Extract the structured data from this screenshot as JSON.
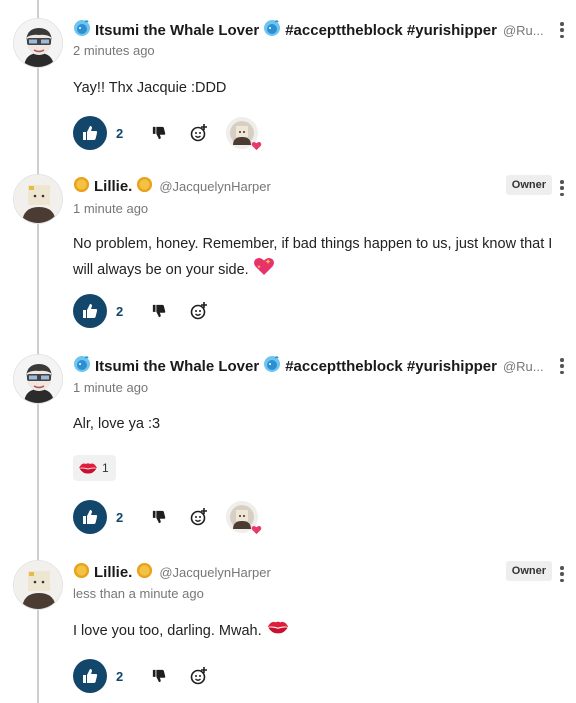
{
  "comments": [
    {
      "author": "Itsumi the Whale Lover",
      "hashtags": "#accepttheblock #yurishipper",
      "handle": "@Ru...",
      "time": "2 minutes ago",
      "text": "Yay!! Thx Jacquie :DDD",
      "likes": "2",
      "owner": ""
    },
    {
      "author": "Lillie.",
      "hashtags": "",
      "handle": "@JacquelynHarper",
      "time": "1 minute ago",
      "text": "No problem, honey. Remember, if bad things happen to us, just know that I will always be on your side.",
      "likes": "2",
      "owner": "Owner"
    },
    {
      "author": "Itsumi the Whale Lover",
      "hashtags": "#accepttheblock #yurishipper",
      "handle": "@Ru...",
      "time": "1 minute ago",
      "text": "Alr, love ya :3",
      "likes": "2",
      "owner": "",
      "reaction_count": "1"
    },
    {
      "author": "Lillie.",
      "hashtags": "",
      "handle": "@JacquelynHarper",
      "time": "less than a minute ago",
      "text": "I love you too, darling. Mwah.",
      "likes": "2",
      "owner": "Owner"
    }
  ],
  "colors": {
    "like_button": "#13466b",
    "owner_badge_bg": "#eeeeee",
    "thread_line": "#cfcfcf"
  },
  "icons": [
    "whale-emoji",
    "sun-emoji",
    "thumbs-up-icon",
    "thumbs-down-icon",
    "add-reaction-icon",
    "sparkling-heart-emoji",
    "kiss-mark-emoji",
    "more-vertical-icon"
  ]
}
